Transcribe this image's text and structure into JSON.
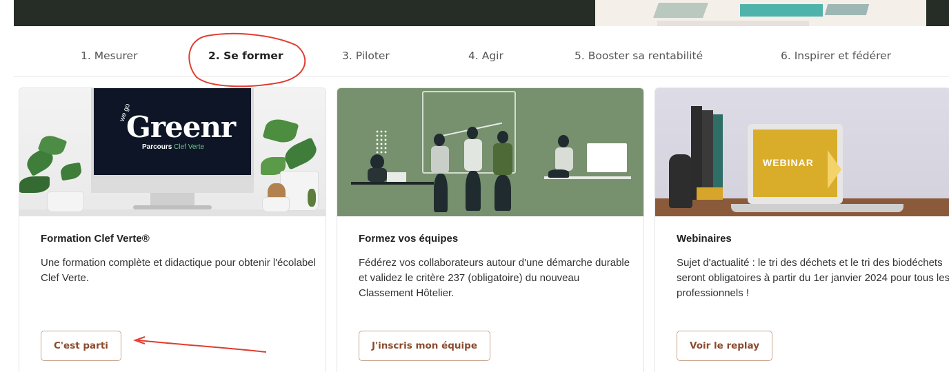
{
  "tabs": [
    {
      "label": "1. Mesurer",
      "active": false
    },
    {
      "label": "2. Se former",
      "active": true
    },
    {
      "label": "3. Piloter",
      "active": false
    },
    {
      "label": "4. Agir",
      "active": false
    },
    {
      "label": "5. Booster sa rentabilité",
      "active": false
    },
    {
      "label": "6. Inspirer et fédérer",
      "active": false
    }
  ],
  "cards": [
    {
      "title": "Formation Clef Verte®",
      "description": "Une formation complète et didactique pour obtenir l'écolabel Clef Verte.",
      "button": "C'est parti",
      "image": {
        "logo_prefix": "we go",
        "logo": "Greenr",
        "subtitle_prefix": "Parcours",
        "subtitle_accent": "Clef Verte"
      }
    },
    {
      "title": "Formez vos équipes",
      "description": "Fédérez vos collaborateurs autour d'une démarche durable et validez le critère 237 (obligatoire) du nouveau Classement Hôtelier.",
      "button": "J'inscris mon équipe",
      "image": {}
    },
    {
      "title": "Webinaires",
      "description": "Sujet d'actualité : le tri des déchets et le tri des biodéchets seront obligatoires à partir du 1er janvier 2024 pour tous les professionnels !",
      "button": "Voir le replay",
      "image": {
        "label": "WEBINAR"
      }
    }
  ],
  "colors": {
    "banner_dark": "#252d26",
    "button_text": "#8b4a2d",
    "button_border": "#c7a38a",
    "annotation": "#e23b2e",
    "card2_bg": "#77906e",
    "webinar_yellow": "#d9ac2a"
  }
}
